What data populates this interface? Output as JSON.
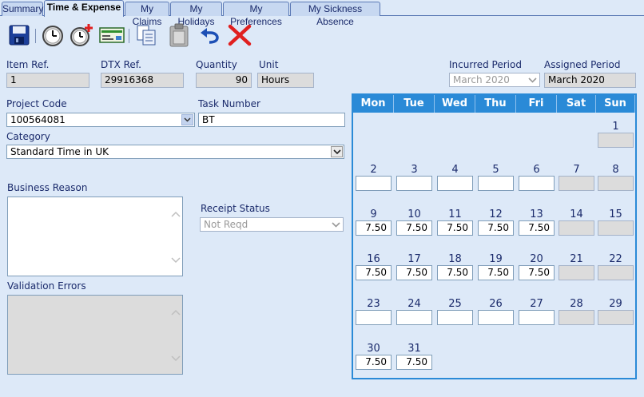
{
  "tabs": [
    "Summary",
    "Time & Expense",
    "My Claims",
    "My Holidays",
    "My Preferences",
    "My Sickness Absence"
  ],
  "active_tab": "Time & Expense",
  "toolbar": {
    "icons": [
      "save-icon",
      "clock-icon",
      "add-clock-icon",
      "cheque-icon",
      "copy-icon",
      "paste-icon",
      "undo-icon",
      "delete-icon"
    ]
  },
  "fields": {
    "item_ref": {
      "label": "Item Ref.",
      "value": "1"
    },
    "dtx_ref": {
      "label": "DTX Ref.",
      "value": "29916368"
    },
    "quantity": {
      "label": "Quantity",
      "value": "90"
    },
    "unit": {
      "label": "Unit",
      "value": "Hours"
    },
    "incurred_period": {
      "label": "Incurred Period",
      "value": "March 2020"
    },
    "assigned_period": {
      "label": "Assigned Period",
      "value": "March 2020"
    },
    "project_code": {
      "label": "Project Code",
      "value": "100564081"
    },
    "task_number": {
      "label": "Task Number",
      "value": "BT"
    },
    "category": {
      "label": "Category",
      "value": "Standard Time in UK"
    },
    "business_reason": {
      "label": "Business Reason",
      "value": ""
    },
    "receipt_status": {
      "label": "Receipt Status",
      "value": "Not Reqd"
    },
    "validation_errors": {
      "label": "Validation Errors",
      "value": ""
    }
  },
  "calendar": {
    "weekdays": [
      "Mon",
      "Tue",
      "Wed",
      "Thu",
      "Fri",
      "Sat",
      "Sun"
    ],
    "weeks": [
      [
        null,
        null,
        null,
        null,
        null,
        null,
        {
          "day": "1",
          "hours": "",
          "weekend": true
        }
      ],
      [
        {
          "day": "2",
          "hours": ""
        },
        {
          "day": "3",
          "hours": ""
        },
        {
          "day": "4",
          "hours": ""
        },
        {
          "day": "5",
          "hours": ""
        },
        {
          "day": "6",
          "hours": ""
        },
        {
          "day": "7",
          "hours": "",
          "weekend": true
        },
        {
          "day": "8",
          "hours": "",
          "weekend": true
        }
      ],
      [
        {
          "day": "9",
          "hours": "7.50"
        },
        {
          "day": "10",
          "hours": "7.50"
        },
        {
          "day": "11",
          "hours": "7.50"
        },
        {
          "day": "12",
          "hours": "7.50"
        },
        {
          "day": "13",
          "hours": "7.50"
        },
        {
          "day": "14",
          "hours": "",
          "weekend": true
        },
        {
          "day": "15",
          "hours": "",
          "weekend": true
        }
      ],
      [
        {
          "day": "16",
          "hours": "7.50"
        },
        {
          "day": "17",
          "hours": "7.50"
        },
        {
          "day": "18",
          "hours": "7.50"
        },
        {
          "day": "19",
          "hours": "7.50"
        },
        {
          "day": "20",
          "hours": "7.50"
        },
        {
          "day": "21",
          "hours": "",
          "weekend": true
        },
        {
          "day": "22",
          "hours": "",
          "weekend": true
        }
      ],
      [
        {
          "day": "23",
          "hours": ""
        },
        {
          "day": "24",
          "hours": ""
        },
        {
          "day": "25",
          "hours": ""
        },
        {
          "day": "26",
          "hours": ""
        },
        {
          "day": "27",
          "hours": ""
        },
        {
          "day": "28",
          "hours": "",
          "weekend": true
        },
        {
          "day": "29",
          "hours": "",
          "weekend": true
        }
      ],
      [
        {
          "day": "30",
          "hours": "7.50"
        },
        {
          "day": "31",
          "hours": "7.50"
        },
        null,
        null,
        null,
        null,
        null
      ]
    ]
  },
  "colors": {
    "accent": "#2a8ad7",
    "background": "#dde9f8",
    "delete": "#e02020",
    "undo": "#1c4fb5"
  }
}
